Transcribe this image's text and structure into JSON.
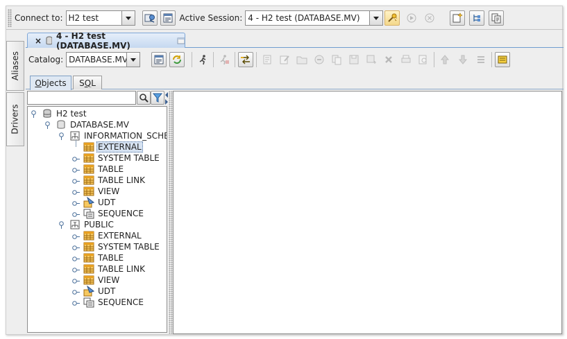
{
  "toolbar": {
    "connect_label": "Connect to:",
    "connect_value": "H2 test",
    "active_session_label": "Active Session:",
    "active_session_value": "4 - H2 test (DATABASE.MV)"
  },
  "side_tabs": {
    "aliases": "Aliases",
    "drivers": "Drivers"
  },
  "session_tab": {
    "close": "×",
    "title": "4 - H2 test (DATABASE.MV)"
  },
  "session_toolbar": {
    "catalog_label": "Catalog:",
    "catalog_value": "DATABASE.MV"
  },
  "inner_tabs": {
    "objects_prefix": "",
    "objects_mnemonic": "O",
    "objects_rest": "bjects",
    "sql_prefix": "S",
    "sql_mnemonic": "Q",
    "sql_rest": "L"
  },
  "search": {
    "value": ""
  },
  "tree": {
    "root": "H2 test",
    "catalog": "DATABASE.MV",
    "schema1": {
      "name": "INFORMATION_SCHE",
      "items": [
        "EXTERNAL",
        "SYSTEM TABLE",
        "TABLE",
        "TABLE LINK",
        "VIEW",
        "UDT",
        "SEQUENCE"
      ]
    },
    "schema2": {
      "name": "PUBLIC",
      "items": [
        "EXTERNAL",
        "SYSTEM TABLE",
        "TABLE",
        "TABLE LINK",
        "VIEW",
        "UDT",
        "SEQUENCE"
      ]
    }
  },
  "colors": {
    "accent": "#7ea6d6",
    "selection": "#d7e3f2",
    "table_icon": "#f0b040",
    "pane_border": "#8c8c8c"
  }
}
